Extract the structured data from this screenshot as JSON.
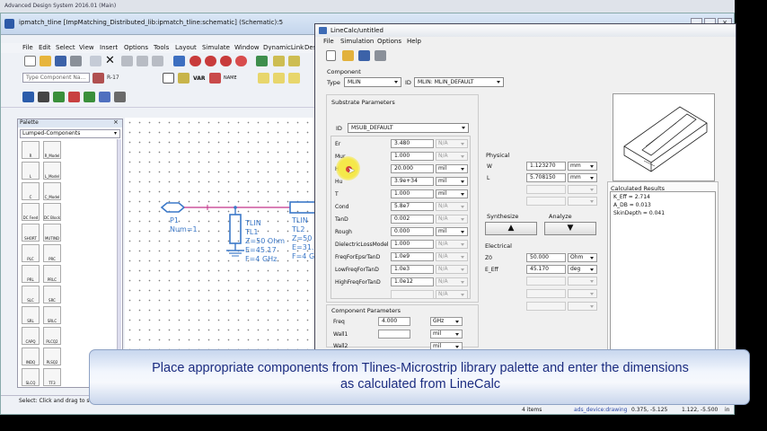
{
  "ads_window": {
    "title": "ipmatch_tline [ImpMatching_Distributed_lib:ipmatch_tline:schematic] (Schematic):5",
    "menu": [
      "File",
      "Edit",
      "Select",
      "View",
      "Insert",
      "Options",
      "Tools",
      "Layout",
      "Simulate",
      "Window",
      "DynamicLink",
      "Design"
    ],
    "component_search_placeholder": "Type Component Na...",
    "toolbar_labels": {
      "var": "VAR",
      "name": "NAME",
      "r17": "R-17"
    },
    "status_text": "Select: Click and drag to s",
    "status_right": [
      "4 items",
      "ads_device:drawing",
      "0.375, -5.125",
      "1.122, -5.500",
      "in"
    ]
  },
  "behind_window": {
    "title": "Advanced Design System 2016.01 (Main)"
  },
  "palette": {
    "title": "Palette",
    "library": "Lumped-Components",
    "items": [
      "R",
      "R_Model",
      "L",
      "L_Model",
      "C",
      "C_Model",
      "DC Feed",
      "DC Block",
      "SHORT",
      "MUTIND",
      "PLC",
      "PRC",
      "PRL",
      "PRLC",
      "SLC",
      "SRC",
      "SRL",
      "SRLC",
      "CAPQ",
      "PLCQ2",
      "INDQ",
      "PLSQ2",
      "SLCQ",
      "TF3"
    ]
  },
  "schematic": {
    "port": {
      "name": "P1",
      "num": "Num=1"
    },
    "tl1": {
      "type": "TLIN",
      "name": "TL1",
      "z": "Z=50 Ohm",
      "e": "E=45.17",
      "f": "F=4 GHz"
    },
    "tl2": {
      "type": "TLIN",
      "name": "TL2",
      "z": "Z=50 O",
      "e": "E=31.",
      "f": "F=4 GH"
    }
  },
  "linecalc": {
    "title": "LineCalc/untitled",
    "menu": [
      "File",
      "Simulation",
      "Options",
      "Help"
    ],
    "component_label": "Component",
    "type_label": "Type",
    "type_value": "MLIN",
    "id_label": "ID",
    "id_value": "MLIN: MLIN_DEFAULT",
    "substrate": {
      "title": "Substrate Parameters",
      "id_label": "ID",
      "id_value": "MSUB_DEFAULT",
      "params": [
        {
          "name": "Er",
          "value": "3.480",
          "unit": "N/A",
          "enabled": false
        },
        {
          "name": "Mur",
          "value": "1.000",
          "unit": "N/A",
          "enabled": false
        },
        {
          "name": "H",
          "value": "20.000",
          "unit": "mil",
          "enabled": true
        },
        {
          "name": "Hu",
          "value": "3.9e+34",
          "unit": "mil",
          "enabled": true
        },
        {
          "name": "T",
          "value": "1.000",
          "unit": "mil",
          "enabled": true
        },
        {
          "name": "Cond",
          "value": "5.8e7",
          "unit": "N/A",
          "enabled": false
        },
        {
          "name": "TanD",
          "value": "0.002",
          "unit": "N/A",
          "enabled": false
        },
        {
          "name": "Rough",
          "value": "0.000",
          "unit": "mil",
          "enabled": true
        },
        {
          "name": "DielectricLossModel",
          "value": "1.000",
          "unit": "N/A",
          "enabled": false
        },
        {
          "name": "FreqForEpsrTanD",
          "value": "1.0e9",
          "unit": "N/A",
          "enabled": false
        },
        {
          "name": "LowFreqForTanD",
          "value": "1.0e3",
          "unit": "N/A",
          "enabled": false
        },
        {
          "name": "HighFreqForTanD",
          "value": "1.0e12",
          "unit": "N/A",
          "enabled": false
        },
        {
          "name": "",
          "value": "",
          "unit": "N/A",
          "enabled": false
        }
      ]
    },
    "component_params": {
      "title": "Component Parameters",
      "params": [
        {
          "name": "Freq",
          "value": "4.000",
          "unit": "GHz"
        },
        {
          "name": "Wall1",
          "value": "",
          "unit": "mil"
        },
        {
          "name": "Wall2",
          "value": "",
          "unit": "mil"
        }
      ]
    },
    "physical": {
      "title": "Physical",
      "w_label": "W",
      "w_value": "1.123270",
      "w_unit": "mm",
      "l_label": "L",
      "l_value": "5.708150",
      "l_unit": "mm"
    },
    "synthesize_label": "Synthesize",
    "analyze_label": "Analyze",
    "electrical": {
      "title": "Electrical",
      "z0_label": "Z0",
      "z0_value": "50.000",
      "z0_unit": "Ohm",
      "eeff_label": "E_Eff",
      "eeff_value": "45.170",
      "eeff_unit": "deg"
    },
    "results": {
      "title": "Calculated Results",
      "lines": [
        "K_Eff = 2.714",
        "A_DB = 0.013",
        "SkinDepth = 0.041"
      ]
    }
  },
  "banner": {
    "line1": "Place appropriate components from Tlines-Microstrip library palette and enter the dimensions",
    "line2": "as calculated from LineCalc"
  },
  "colors": {
    "title_text": "#1b2c80",
    "component_blue": "#3b78c8",
    "wire_pink": "#c2338a",
    "cursor_yellow": "#f7e84a"
  }
}
